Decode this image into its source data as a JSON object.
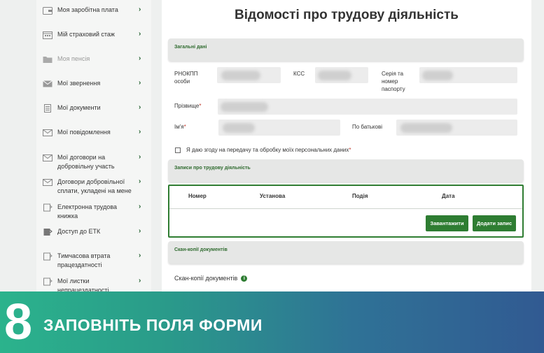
{
  "sidebar": {
    "items": [
      {
        "label": "Моя заробітна плата",
        "icon": "wallet-icon"
      },
      {
        "label": "Мій страховий стаж",
        "icon": "calendar-icon"
      },
      {
        "label": "Моя пенсія",
        "icon": "folder-icon",
        "disabled": true
      },
      {
        "label": "Мої звернення",
        "icon": "envelope-icon"
      },
      {
        "label": "Мої документи",
        "icon": "document-icon"
      },
      {
        "label": "Мої повідомлення",
        "icon": "envelope-icon"
      },
      {
        "label": "Мої договори на добровільну участь",
        "icon": "envelope-icon"
      },
      {
        "label": "Договори добровільної сплати, укладені на мене",
        "icon": "envelope-icon"
      },
      {
        "label": "Електронна трудова книжка",
        "icon": "book-icon"
      },
      {
        "label": "Доступ до ЕТК",
        "icon": "book-icon"
      },
      {
        "label": "Тимчасова втрата працездатності",
        "icon": "book-icon"
      },
      {
        "label": "Мої листки непрацездатності",
        "icon": "book-icon"
      }
    ]
  },
  "main": {
    "title": "Відомості про трудову діяльність",
    "general_section": "Загальні дані",
    "fields": {
      "rnokpp_label": "РНОКПП особи",
      "kss_label": "КСС",
      "passport_label": "Серія та номер паспорту",
      "surname_label": "Прізвище",
      "name_label": "Ім'я",
      "patronymic_label": "По батькові",
      "required_mark": "*"
    },
    "consent_text": "Я даю згоду на передачу та обробку моїх персональних даних",
    "records_section": "Записи про трудову діяльність",
    "table": {
      "columns": [
        "Номер",
        "Установа",
        "Подія",
        "Дата"
      ]
    },
    "buttons": {
      "upload": "Завантажити",
      "add_record": "Додати запис"
    },
    "scans_section": "Скан-копії документів",
    "scans_label": "Скан-копії документів"
  },
  "banner": {
    "step_number": "8",
    "text": "ЗАПОВНІТЬ ПОЛЯ ФОРМИ",
    "colors": {
      "start": "#2bb38c",
      "end": "#315a92"
    }
  },
  "colors": {
    "accent": "#2e7d32",
    "required": "#c0392b"
  }
}
